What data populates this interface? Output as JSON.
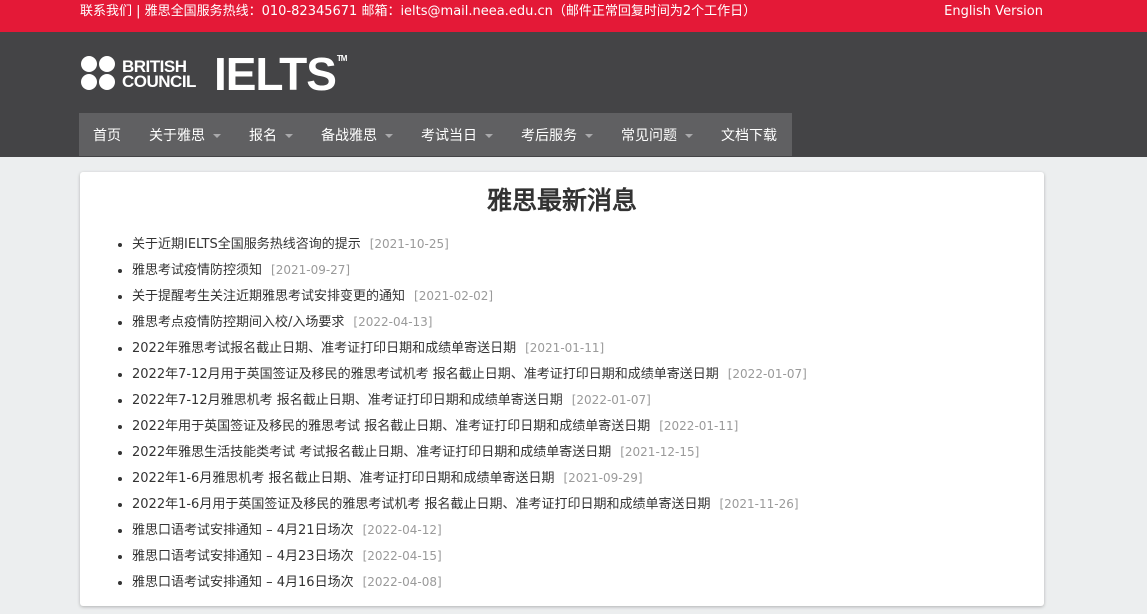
{
  "topbar": {
    "contact_text": "联系我们 | 雅思全国服务热线：010-82345671   邮箱：ielts@mail.neea.edu.cn（邮件正常回复时间为2个工作日）",
    "lang_link": "English Version"
  },
  "header": {
    "logo": {
      "british": "BRITISH",
      "council": "COUNCIL",
      "ielts": "IELTS",
      "tm": "TM"
    }
  },
  "nav": {
    "items": [
      {
        "label": "首页",
        "has_dropdown": false
      },
      {
        "label": "关于雅思",
        "has_dropdown": true
      },
      {
        "label": "报名",
        "has_dropdown": true
      },
      {
        "label": "备战雅思",
        "has_dropdown": true
      },
      {
        "label": "考试当日",
        "has_dropdown": true
      },
      {
        "label": "考后服务",
        "has_dropdown": true
      },
      {
        "label": "常见问题",
        "has_dropdown": true
      },
      {
        "label": "文档下载",
        "has_dropdown": false
      }
    ]
  },
  "main": {
    "title": "雅思最新消息",
    "news": [
      {
        "title": "关于近期IELTS全国服务热线咨询的提示",
        "date": "[2021-10-25]"
      },
      {
        "title": "雅思考试疫情防控须知",
        "date": "[2021-09-27]"
      },
      {
        "title": "关于提醒考生关注近期雅思考试安排变更的通知",
        "date": "[2021-02-02]"
      },
      {
        "title": "雅思考点疫情防控期间入校/入场要求",
        "date": "[2022-04-13]"
      },
      {
        "title": "2022年雅思考试报名截止日期、准考证打印日期和成绩单寄送日期",
        "date": "[2021-01-11]"
      },
      {
        "title": "2022年7-12月用于英国签证及移民的雅思考试机考 报名截止日期、准考证打印日期和成绩单寄送日期",
        "date": "[2022-01-07]"
      },
      {
        "title": "2022年7-12月雅思机考 报名截止日期、准考证打印日期和成绩单寄送日期",
        "date": "[2022-01-07]"
      },
      {
        "title": "2022年用于英国签证及移民的雅思考试 报名截止日期、准考证打印日期和成绩单寄送日期",
        "date": "[2022-01-11]"
      },
      {
        "title": "2022年雅思生活技能类考试 考试报名截止日期、准考证打印日期和成绩单寄送日期",
        "date": "[2021-12-15]"
      },
      {
        "title": "2022年1-6月雅思机考 报名截止日期、准考证打印日期和成绩单寄送日期",
        "date": "[2021-09-29]"
      },
      {
        "title": "2022年1-6月用于英国签证及移民的雅思考试机考 报名截止日期、准考证打印日期和成绩单寄送日期",
        "date": "[2021-11-26]"
      },
      {
        "title": "雅思口语考试安排通知 – 4月21日场次",
        "date": "[2022-04-12]"
      },
      {
        "title": "雅思口语考试安排通知 – 4月23日场次",
        "date": "[2022-04-15]"
      },
      {
        "title": "雅思口语考试安排通知 – 4月16日场次",
        "date": "[2022-04-08]"
      }
    ]
  },
  "colors": {
    "topbar_bg": "#e41937",
    "header_bg": "#444446",
    "nav_bg": "#606062",
    "page_bg": "#eceeef",
    "date_text": "#9a9a9a"
  }
}
